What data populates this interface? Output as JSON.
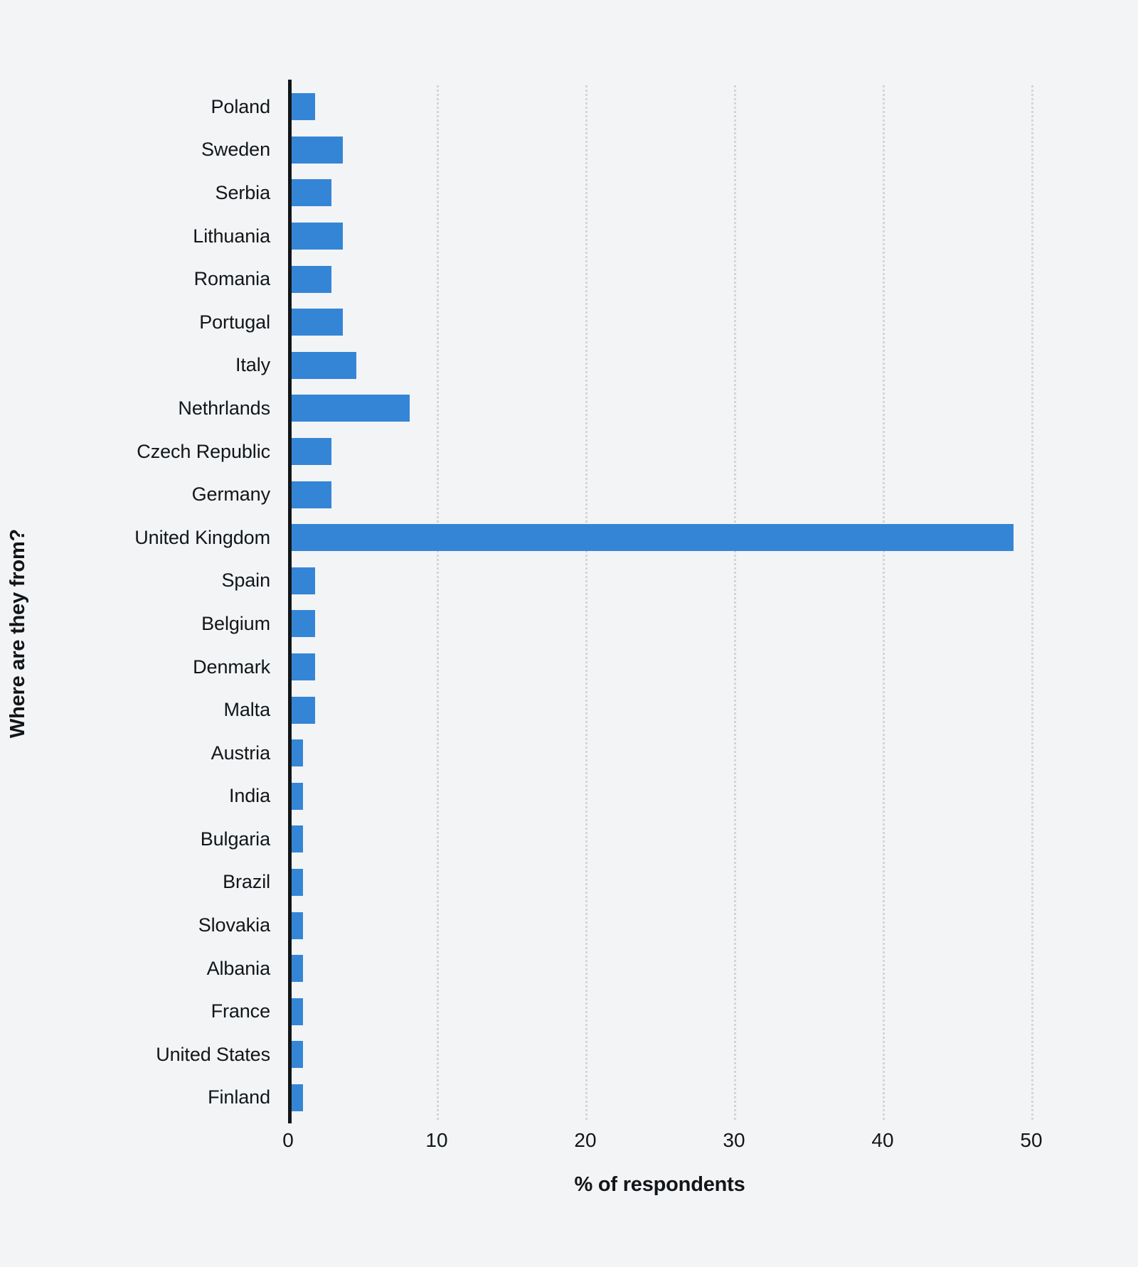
{
  "chart_data": {
    "type": "bar",
    "orientation": "horizontal",
    "title": "",
    "xlabel": "% of respondents",
    "ylabel": "Where are they from?",
    "xlim": [
      0,
      52
    ],
    "xticks": [
      0,
      10,
      20,
      30,
      40,
      50
    ],
    "xtick_labels": [
      "0",
      "10",
      "20",
      "30",
      "40",
      "50"
    ],
    "grid": "vertical-dotted",
    "legend": null,
    "bar_color": "#3585d6",
    "background_color": "#f2f4f6",
    "axis_color": "#121619",
    "gridline_color": "#d3d5d7",
    "categories": [
      "Poland",
      "Sweden",
      "Serbia",
      "Lithuania",
      "Romania",
      "Portugal",
      "Italy",
      "Nethrlands",
      "Czech Republic",
      "Germany",
      "United Kingdom",
      "Spain",
      "Belgium",
      "Denmark",
      "Malta",
      "Austria",
      "India",
      "Bulgaria",
      "Brazil",
      "Slovakia",
      "Albania",
      "France",
      "United States",
      "Finland"
    ],
    "values": [
      1.8,
      3.7,
      2.9,
      3.7,
      2.9,
      3.7,
      4.6,
      8.2,
      2.9,
      2.9,
      48.8,
      1.8,
      1.8,
      1.8,
      1.8,
      1.0,
      1.0,
      1.0,
      1.0,
      1.0,
      1.0,
      1.0,
      1.0,
      1.0
    ]
  }
}
